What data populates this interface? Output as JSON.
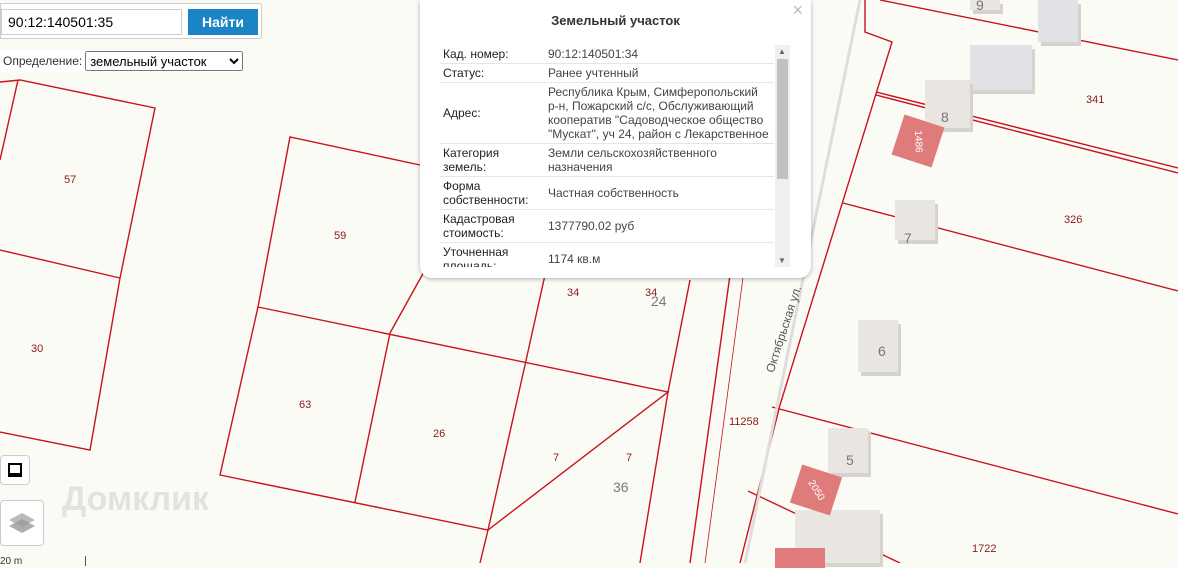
{
  "search": {
    "value": "90:12:140501:35",
    "button": "Найти"
  },
  "definition": {
    "label": "Определение:",
    "selected": "земельный участок"
  },
  "popup": {
    "title": "Земельный участок",
    "close": "×",
    "rows": [
      {
        "k": "Кад. номер:",
        "v": "90:12:140501:34"
      },
      {
        "k": "Статус:",
        "v": "Ранее учтенный"
      },
      {
        "k": "Адрес:",
        "v": "Республика Крым, Симферопольский р-н, Пожарский с/с, Обслуживающий кооператив \"Садоводческое общество \"Мускат\", уч 24, район с Лекарственное"
      },
      {
        "k": "Категория земель:",
        "v": "Земли сельскохозяйственного назначения"
      },
      {
        "k": "Форма собственности:",
        "v": "Частная собственность"
      },
      {
        "k": "Кадастровая стоимость:",
        "v": "1377790.02 руб"
      },
      {
        "k": "Уточненная площадь:",
        "v": "1174 кв.м"
      }
    ]
  },
  "map": {
    "parcels": [
      "57",
      "30",
      "59",
      "63",
      "26",
      "7",
      "7",
      "34",
      "34",
      "11258",
      "341",
      "326",
      "1722"
    ],
    "houses": [
      "9",
      "8",
      "7",
      "6",
      "5",
      "24",
      "36"
    ],
    "buildings": [
      "1486",
      "2050"
    ],
    "street": "Октябрьская ул.",
    "watermark": "Домклик",
    "scale": "20 m"
  }
}
